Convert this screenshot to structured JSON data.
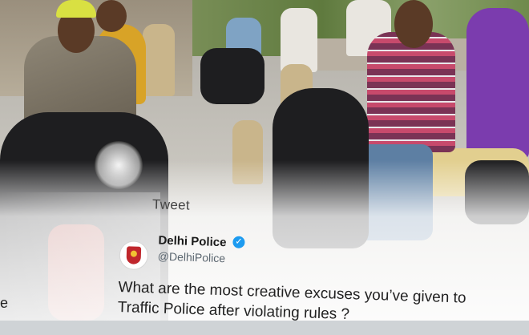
{
  "tweet": {
    "label": "Tweet",
    "account_name": "Delhi Police",
    "handle": "@DelhiPolice",
    "text_line1": "What are the most creative excuses you’ve given to",
    "text_line2": "Traffic Police after violating rules ?",
    "cutoff_left_text": "e",
    "verified_color": "#1d9bf0",
    "avatar_icon": "delhi-police-badge-icon"
  }
}
